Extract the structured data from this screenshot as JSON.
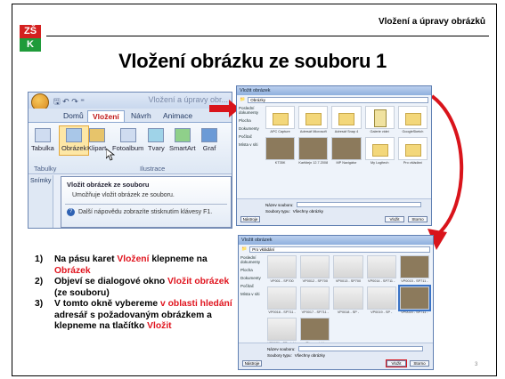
{
  "header": {
    "logo_top": "ZŠ",
    "logo_bottom": "K",
    "section": "Vložení a úpravy obrázků",
    "title": "Vložení obrázku ze souboru 1"
  },
  "ribbon": {
    "quick_access": "🖫 ↶ ↷ ⁼",
    "doc_title": "Vložení a úpravy obr...",
    "tabs": [
      "Domů",
      "Vložení",
      "Návrh",
      "Animace"
    ],
    "active_tab": "Vložení",
    "buttons": [
      "Tabulka",
      "Obrázek",
      "Klipart",
      "Fotoalbum",
      "Tvary",
      "SmartArt",
      "Graf"
    ],
    "groups": [
      "Tabulky",
      "Ilustrace"
    ],
    "side_labels": [
      "Snímky",
      ""
    ],
    "tooltip_title": "Vložit obrázek ze souboru",
    "tooltip_desc": "Umožňuje vložit obrázek ze souboru.",
    "tooltip_help": "Další nápovědu zobrazíte stisknutím klávesy F1."
  },
  "dialog1": {
    "title": "Vložit obrázek",
    "address": "Obrázky",
    "nav": [
      "Poslední dokumenty",
      "Plocha",
      "Dokumenty",
      "Počítač",
      "Místa v síti"
    ],
    "thumbs": [
      {
        "kind": "folder",
        "cap": "APC Capture"
      },
      {
        "kind": "folder",
        "cap": "Adresář Microsoft Office"
      },
      {
        "kind": "folder",
        "cap": "Adresář Snap 4"
      },
      {
        "kind": "doc",
        "cap": "Galerie videí"
      },
      {
        "kind": "folder",
        "cap": "GoogleSketch"
      },
      {
        "kind": "pic",
        "cap": "KT35K"
      },
      {
        "kind": "pic",
        "cap": "Karlštejn 12.7.2008"
      },
      {
        "kind": "pic",
        "cap": "MP Navigátor"
      },
      {
        "kind": "folder",
        "cap": "My Logitech Pictures"
      },
      {
        "kind": "folder",
        "cap": "Pro vkládání"
      }
    ],
    "name_label": "Název souboru:",
    "type_label": "Soubory typu:",
    "type_value": "Všechny obrázky",
    "tools_btn": "Nástroje",
    "insert_btn": "Vložit",
    "cancel_btn": "Storno"
  },
  "dialog2": {
    "title": "Vložit obrázek",
    "address": "Pro vkládání",
    "nav": [
      "Poslední dokumenty",
      "Plocha",
      "Dokumenty",
      "Počítač",
      "Místa v síti"
    ],
    "thumbs": [
      {
        "kind": "scr",
        "cap": "VP001 - SP700 textová plocha"
      },
      {
        "kind": "scr",
        "cap": "VP0012 - SP700 textová plocha"
      },
      {
        "kind": "scr",
        "cap": "VP0013 - SP700 textová plocha"
      },
      {
        "kind": "scr",
        "cap": "VP0014 - SP711 - 700"
      },
      {
        "kind": "pic",
        "cap": "VP0015 - SP711 - jaký obraz"
      },
      {
        "kind": "scr",
        "cap": "VP0016 - SP711 - 800"
      },
      {
        "kind": "scr",
        "cap": "VP0017 - SP711 - 800"
      },
      {
        "kind": "scr",
        "cap": "VP0018 - SP - úpravy obrázku"
      },
      {
        "kind": "scr",
        "cap": "VP0019 - SP - úpravy obrázku"
      },
      {
        "kind": "pic",
        "cap": "VP0020 - SP711 - jaký obraz"
      },
      {
        "kind": "scr",
        "cap": "VP0021 - SP - jaký obraz - 700"
      },
      {
        "kind": "pic",
        "cap": "Zlín - projekt"
      }
    ],
    "name_label": "Název souboru:",
    "type_label": "Soubory typu:",
    "type_value": "Všechny obrázky",
    "tools_btn": "Nástroje",
    "insert_btn": "Vložit",
    "cancel_btn": "Storno"
  },
  "steps": [
    {
      "num": "1)",
      "parts": [
        {
          "t": "Na pásu karet ",
          "red": false
        },
        {
          "t": "Vložení",
          "red": true
        },
        {
          "t": " klepneme na ",
          "red": false
        },
        {
          "t": "Obrázek",
          "red": true
        }
      ]
    },
    {
      "num": "2)",
      "parts": [
        {
          "t": "Objeví se dialogové okno ",
          "red": false
        },
        {
          "t": "Vložit obrázek",
          "red": true
        },
        {
          "t": " (ze souboru)",
          "red": false
        }
      ]
    },
    {
      "num": "3)",
      "parts": [
        {
          "t": "V tomto okně vybereme ",
          "red": false
        },
        {
          "t": "v oblasti hledání",
          "red": true
        },
        {
          "t": " adresář s požadovaným obrázkem a klepneme na tlačítko ",
          "red": false
        },
        {
          "t": "Vložit",
          "red": true
        }
      ]
    }
  ],
  "page_number": "3",
  "colors": {
    "accent_red": "#e0141e",
    "arrow_red": "#d9141b",
    "logo_red": "#d4201f",
    "logo_green": "#1f9b3a"
  }
}
